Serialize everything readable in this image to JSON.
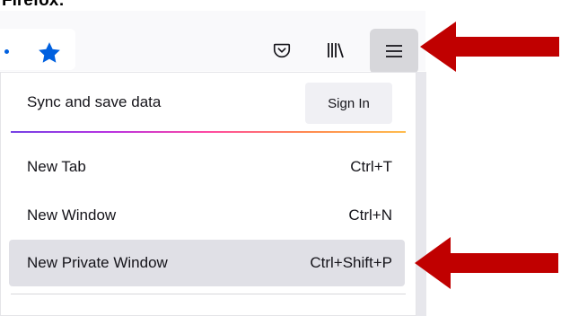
{
  "caption": "Firefox:",
  "toolbar": {
    "buttons": [
      {
        "name": "bookmark-star",
        "icon": "star-icon"
      },
      {
        "name": "pocket",
        "icon": "pocket-icon"
      },
      {
        "name": "library",
        "icon": "library-icon"
      },
      {
        "name": "app-menu",
        "icon": "hamburger-menu-icon",
        "state": "pressed"
      }
    ]
  },
  "menu": {
    "sync": {
      "label": "Sync and save data",
      "button_label": "Sign In"
    },
    "items": [
      {
        "label": "New Tab",
        "shortcut": "Ctrl+T"
      },
      {
        "label": "New Window",
        "shortcut": "Ctrl+N"
      },
      {
        "label": "New Private Window",
        "shortcut": "Ctrl+Shift+P",
        "highlighted": true
      }
    ]
  },
  "annotations": {
    "arrow_color": "#c00000",
    "arrows": [
      "points-to-app-menu-button",
      "points-to-new-private-window"
    ]
  },
  "colors": {
    "accent_star": "#0060df",
    "hover_row": "#e0e0e6",
    "pressed_button": "#d7d7db"
  }
}
